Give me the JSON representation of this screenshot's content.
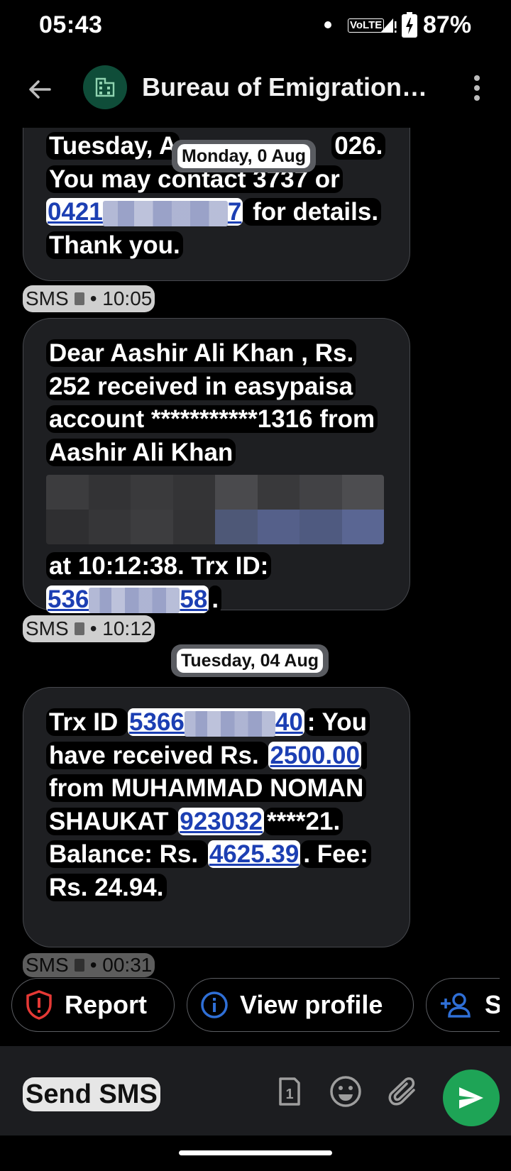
{
  "status_bar": {
    "time": "05:43",
    "volte": "VoLTE",
    "battery": "87%"
  },
  "app_bar": {
    "title": "Bureau of Emigration…",
    "avatar_icon": "business-building-icon",
    "accent": "#0f4d39"
  },
  "messages": [
    {
      "line_prefix": "Tuesday, A",
      "line_suffix": "026.",
      "line2": "You may contact 3737 or",
      "phone_start": "0421",
      "phone_end": "7",
      "phone_after": " for details.",
      "line4": "Thank you.",
      "meta_label": "SMS",
      "meta_time": "• 10:05"
    },
    {
      "text_a": "Dear Aashir Ali Khan  , Rs. 252 received in easypaisa account ***********1316 from Aashir Ali Khan",
      "text_b": "at 10:12:38. Trx ID:",
      "trx_start": "536",
      "trx_end": "58",
      "trx_after": ".",
      "meta_label": "SMS",
      "meta_time": "• 10:12"
    },
    {
      "t1": "Trx ID ",
      "trx_start": "5366",
      "trx_end": "40",
      "t2": ": You have received Rs. ",
      "amount": "2500.00",
      "t3": " from MUHAMMAD NOMAN SHAUKAT ",
      "phone": "923032",
      "t4": "****21. Balance: Rs. ",
      "balance": "4625.39",
      "t5": ". Fee: Rs. 24.94.",
      "meta_label": "SMS",
      "meta_time": "• 00:31"
    }
  ],
  "date_chips": {
    "first": "Monday, 0  Aug",
    "second": "Tuesday, 04 Aug"
  },
  "actions": {
    "report": "Report",
    "view_profile": "View profile",
    "save": "Sa"
  },
  "composer": {
    "placeholder": "Send SMS",
    "sim_number": "1"
  },
  "colors": {
    "send_button": "#1ea456",
    "report_icon": "#e53935",
    "link_blue": "#1c3fb3",
    "profile_icon": "#2f6fd6"
  }
}
